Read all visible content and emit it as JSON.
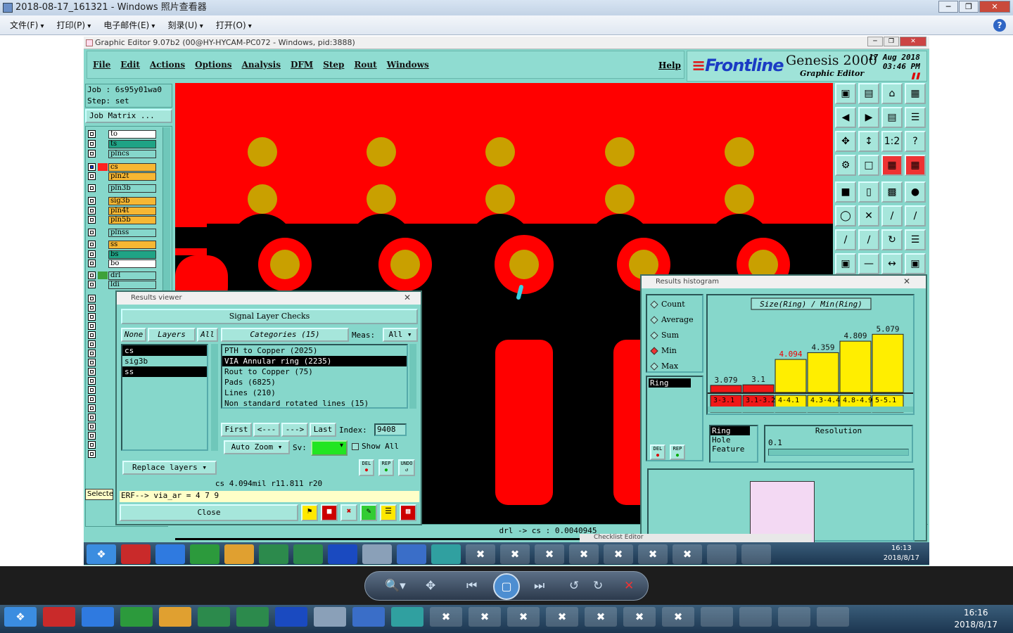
{
  "viewer": {
    "title": "2018-08-17_161321 - Windows 照片查看器",
    "menu": [
      "文件(F)",
      "打印(P)",
      "电子邮件(E)",
      "刻录(U)",
      "打开(O)"
    ],
    "help": "?"
  },
  "genesis": {
    "title": "Graphic Editor 9.07b2 (00@HY-HYCAM-PC072 - Windows, pid:3888)",
    "menu": [
      "File",
      "Edit",
      "Actions",
      "Options",
      "Analysis",
      "DFM",
      "Step",
      "Rout",
      "Windows"
    ],
    "help_menu": "Help",
    "logo_frontline": "Frontline",
    "logo_genesis": "Genesis 2000",
    "logo_subtitle": "Graphic Editor",
    "date": "17 Aug 2018",
    "time": "03:46 PM",
    "job": "Job : 6s95y01wa0",
    "step": "Step: set",
    "job_matrix": "Job Matrix ...",
    "select_label": "Selecte",
    "layers": [
      {
        "name": "to",
        "color": "#ffffff",
        "swatch": "#86d7cb"
      },
      {
        "name": "ts",
        "color": "#1fa385",
        "swatch": "#86d7cb"
      },
      {
        "name": "plncs",
        "color": "#86d7cb",
        "swatch": "#86d7cb"
      },
      {
        "name": "cs",
        "color": "#f7b733",
        "swatch": "#ff2020",
        "active": true
      },
      {
        "name": "pln2t",
        "color": "#f7b733",
        "swatch": "#86d7cb"
      },
      {
        "name": "pln3b",
        "color": "#86d7cb",
        "swatch": "#86d7cb"
      },
      {
        "name": "sig3b",
        "color": "#f7b733",
        "swatch": "#86d7cb"
      },
      {
        "name": "pln4t",
        "color": "#f7b733",
        "swatch": "#86d7cb"
      },
      {
        "name": "pln5b",
        "color": "#f7b733",
        "swatch": "#86d7cb"
      },
      {
        "name": "plnss",
        "color": "#86d7cb",
        "swatch": "#86d7cb"
      },
      {
        "name": "ss",
        "color": "#f7b733",
        "swatch": "#86d7cb"
      },
      {
        "name": "bs",
        "color": "#1fa385",
        "swatch": "#86d7cb"
      },
      {
        "name": "bo",
        "color": "#ffffff",
        "swatch": "#86d7cb"
      },
      {
        "name": "drl",
        "color": "#86d7cb",
        "swatch": "#3ea13a"
      },
      {
        "name": "ldi",
        "color": "#86d7cb",
        "swatch": "#86d7cb"
      }
    ],
    "coord_readout": "drl -> cs : 0.0040945"
  },
  "results_viewer": {
    "title": "Results viewer",
    "header": "Signal Layer Checks",
    "none_btn": "None",
    "layers_btn": "Layers",
    "all_btn": "All",
    "categories_btn": "Categories (15)",
    "meas_label": "Meas:",
    "meas_value": "All",
    "layer_list": [
      {
        "name": "cs",
        "selected": true
      },
      {
        "name": "sig3b",
        "selected": false
      },
      {
        "name": "ss",
        "selected": true
      }
    ],
    "categories": [
      {
        "name": "PTH to Copper (2025)",
        "selected": false
      },
      {
        "name": "VIA Annular ring (2235)",
        "selected": true
      },
      {
        "name": "Rout to Copper (75)",
        "selected": false
      },
      {
        "name": "Pads (6825)",
        "selected": false
      },
      {
        "name": "Lines (210)",
        "selected": false
      },
      {
        "name": "Non standard rotated lines (15)",
        "selected": false
      }
    ],
    "first": "First",
    "prev": "<---",
    "next": "--->",
    "last": "Last",
    "index_label": "Index:",
    "index_value": "9408",
    "auto_zoom": "Auto Zoom",
    "sv_label": "Sv:",
    "show_all": "Show All",
    "replace_layers": "Replace layers",
    "del": "DEL",
    "rep": "REP",
    "undo": "UNDO",
    "measure_line": "cs 4.094mil   r11.811  r20",
    "erf_line": "ERF--> via_ar = 4 7 9",
    "close": "Close"
  },
  "histogram": {
    "title": "Results histogram",
    "options": [
      {
        "label": "Count",
        "on": false
      },
      {
        "label": "Average",
        "on": false
      },
      {
        "label": "Sum",
        "on": false
      },
      {
        "label": "Min",
        "on": true
      },
      {
        "label": "Max",
        "on": false
      }
    ],
    "metric_list": [
      "Ring"
    ],
    "attr_list": [
      "Ring",
      "Hole",
      "Feature"
    ],
    "resolution_label": "Resolution",
    "resolution_value": "0.1",
    "del": "DEL",
    "rep": "REP"
  },
  "chart_data": {
    "type": "bar",
    "title": "Size(Ring) / Min(Ring)",
    "categories": [
      "3-3.1",
      "3.1-3.2",
      "4-4.1",
      "4.3-4.4",
      "4.8-4.9",
      "5-5.1"
    ],
    "values": [
      3.079,
      3.1,
      4.094,
      4.359,
      4.809,
      5.079
    ],
    "value_labels": [
      "3.079",
      "3.1",
      "4.094",
      "4.359",
      "4.809",
      "5.079"
    ],
    "colors": [
      "#f01818",
      "#f01818",
      "#ffee00",
      "#ffee00",
      "#ffee00",
      "#ffee00"
    ],
    "highlight_label_index": 2,
    "ylim": [
      0,
      5.5
    ]
  },
  "taskbar": {
    "inner_time": "16:13",
    "inner_date": "2018/8/17",
    "outer_time": "16:16",
    "outer_date": "2018/8/17"
  },
  "checklist_editor": "Checklist Editor"
}
